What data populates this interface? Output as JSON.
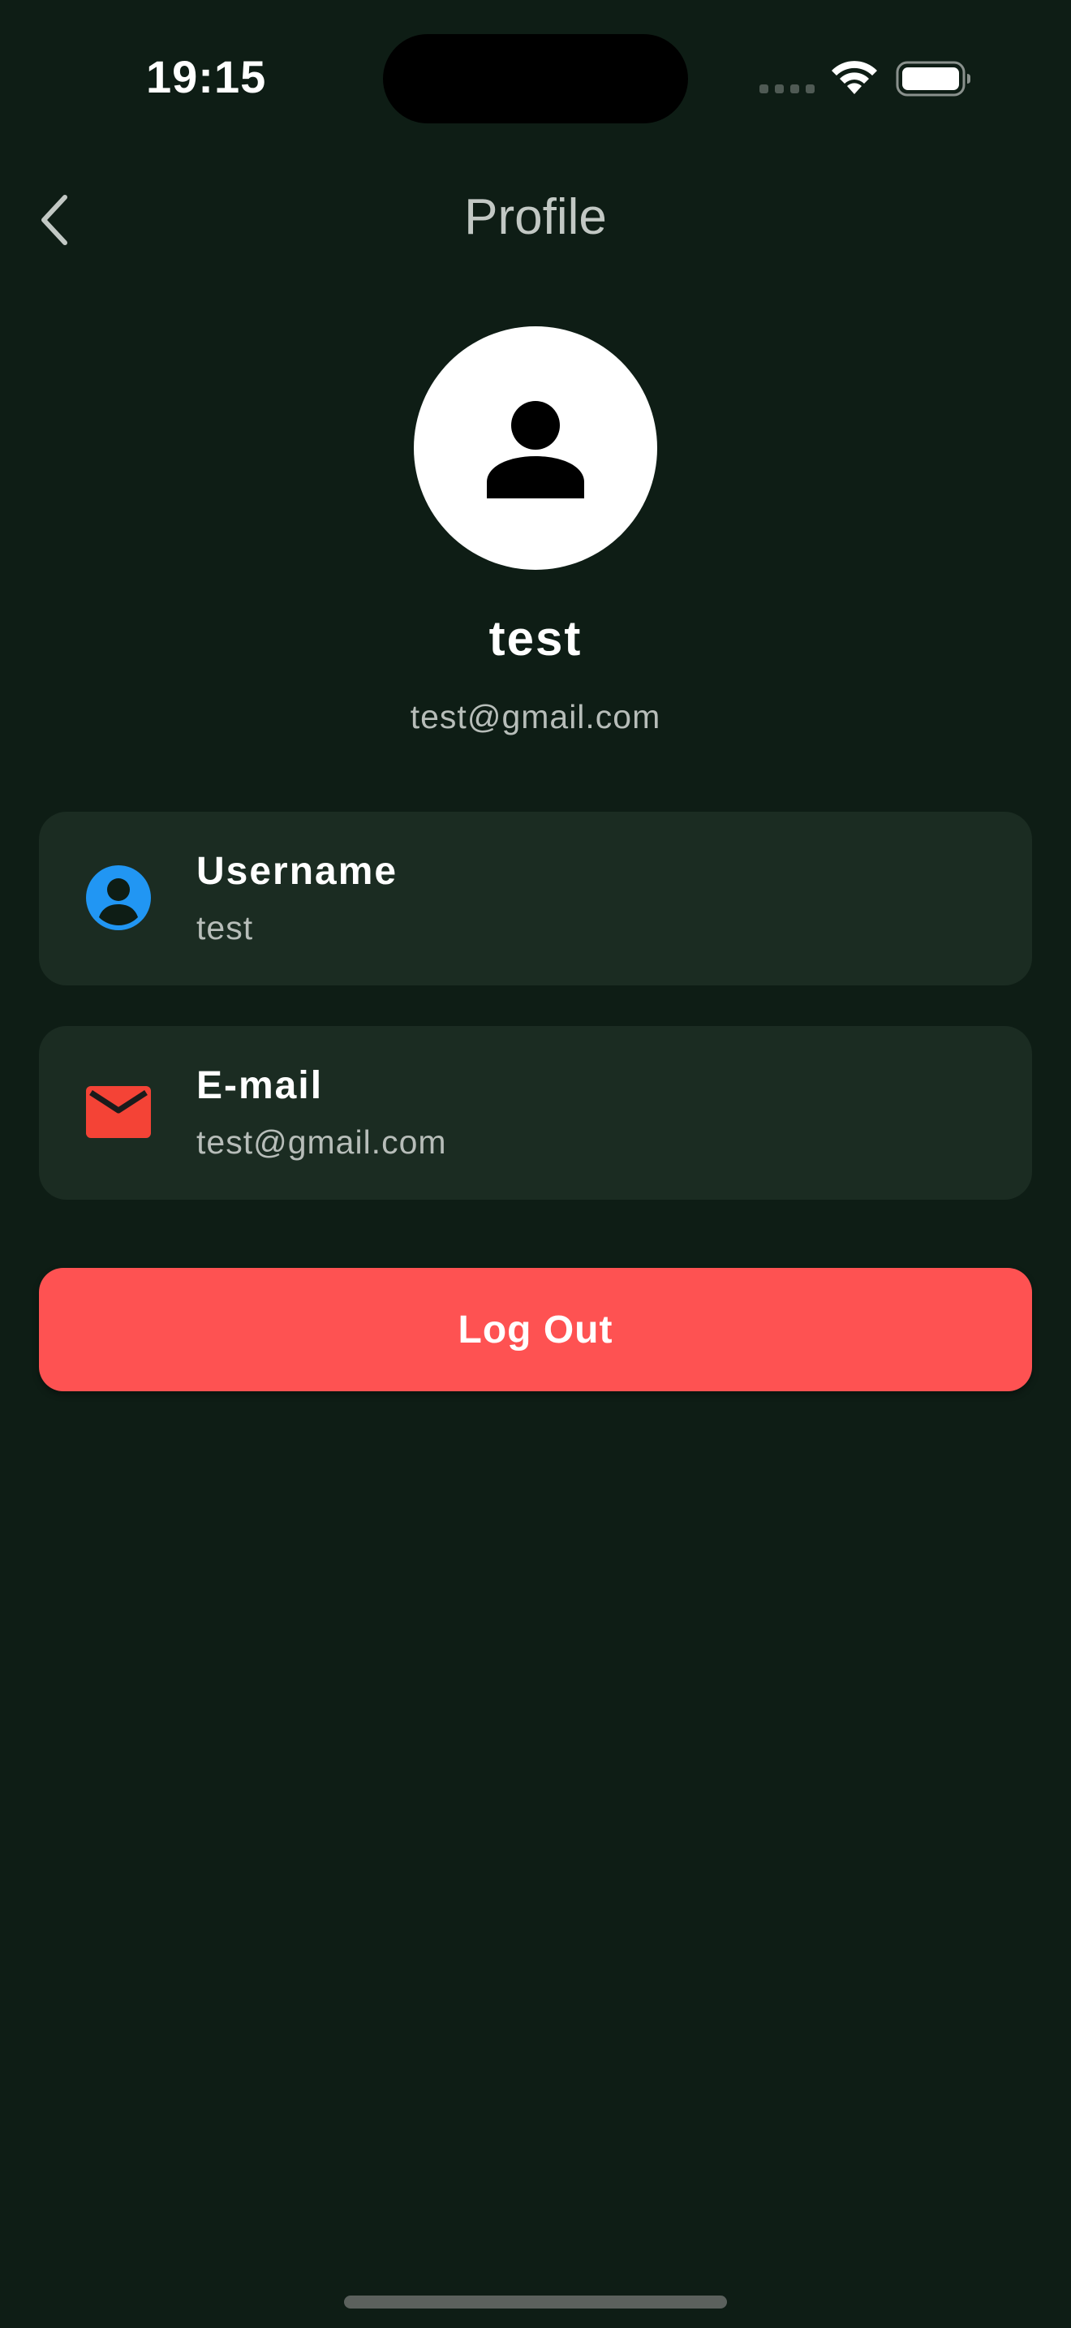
{
  "status_bar": {
    "time": "19:15",
    "icons": [
      "cellular-signal-icon",
      "wifi-icon",
      "battery-icon"
    ]
  },
  "nav": {
    "back_icon": "chevron-left-icon",
    "title": "Profile"
  },
  "profile": {
    "avatar_icon": "person-icon",
    "name": "test",
    "email": "test@gmail.com"
  },
  "info_cards": [
    {
      "icon": "account-circle-icon",
      "icon_color": "#2196f3",
      "label": "Username",
      "value": "test"
    },
    {
      "icon": "mail-icon",
      "icon_color": "#f44336",
      "label": "E-mail",
      "value": "test@gmail.com"
    }
  ],
  "actions": {
    "logout_label": "Log Out",
    "logout_color": "#fe5252"
  },
  "theme": {
    "background": "#0e1d15",
    "card_background": "#1b2c22"
  }
}
